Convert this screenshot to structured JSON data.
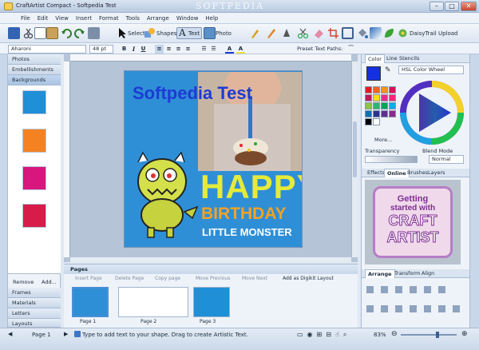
{
  "window": {
    "title": "CraftArtist Compact - Softpedia Test",
    "watermark": "SOFTPEDIA",
    "controls": [
      "–",
      "□",
      "✕"
    ]
  },
  "menu": [
    "File",
    "Edit",
    "View",
    "Insert",
    "Format",
    "Tools",
    "Arrange",
    "Window",
    "Help"
  ],
  "toolbar": {
    "select_label": "Select",
    "shapes_label": "Shapes",
    "text_label": "Text",
    "photo_label": "Photo",
    "upload_label": "DaisyTrail Upload"
  },
  "textbar": {
    "font_name": "Aharoni",
    "font_size": "48 pt",
    "preset_label": "Preset Text Paths:"
  },
  "left_panel": {
    "tabs": [
      "Photos",
      "Embellishments",
      "Backgrounds"
    ],
    "active_tab": "Backgrounds",
    "swatch_colors": [
      "#1f8fd8",
      "#f58220",
      "#d9157e",
      "#d81c49"
    ],
    "remove_label": "Remove",
    "add_label": "Add...",
    "bottom_tabs": [
      "Frames",
      "Materials",
      "Letters",
      "Layouts"
    ]
  },
  "card": {
    "headline": "Softpedia Test",
    "line1": "HAPPY",
    "line2": "BIRTHDAY",
    "line3": "LITTLE MONSTER"
  },
  "pages": {
    "header": "Pages",
    "actions": [
      "Insert Page",
      "Delete Page",
      "Copy page",
      "Move Previous",
      "Move Next",
      "Add as Digikit Layout"
    ],
    "thumbs": [
      "Page 1",
      "Page 2",
      "Page 3"
    ]
  },
  "right_panel": {
    "tabs": [
      "Color",
      "Line",
      "Stencils"
    ],
    "color_model": "HSL Color Wheel",
    "more_label": "More...",
    "transparency_label": "Transparency",
    "blend_label": "Blend Mode",
    "blend_value": "Normal",
    "effects_tabs": [
      "Effects",
      "Online",
      "Brushes",
      "Layers"
    ],
    "promo_lines": [
      "Getting",
      "started with",
      "CRAFT",
      "ARTIST"
    ],
    "arrange_tabs": [
      "Arrange",
      "Transform",
      "Align"
    ],
    "palette_colors": [
      "#e31b23",
      "#f26522",
      "#f7941d",
      "#d4145a",
      "#c2185b",
      "#ffde17",
      "#e52f86",
      "#ee2a7b",
      "#8dc63f",
      "#2bb673",
      "#00a651",
      "#00aeef",
      "#0072bc",
      "#2e3192",
      "#662d91",
      "#92278f",
      "#000000",
      "#ffffff"
    ]
  },
  "status": {
    "page": "Page 1",
    "hint": "Type to add text to your shape. Drag to create Artistic Text.",
    "zoom": "83%"
  }
}
